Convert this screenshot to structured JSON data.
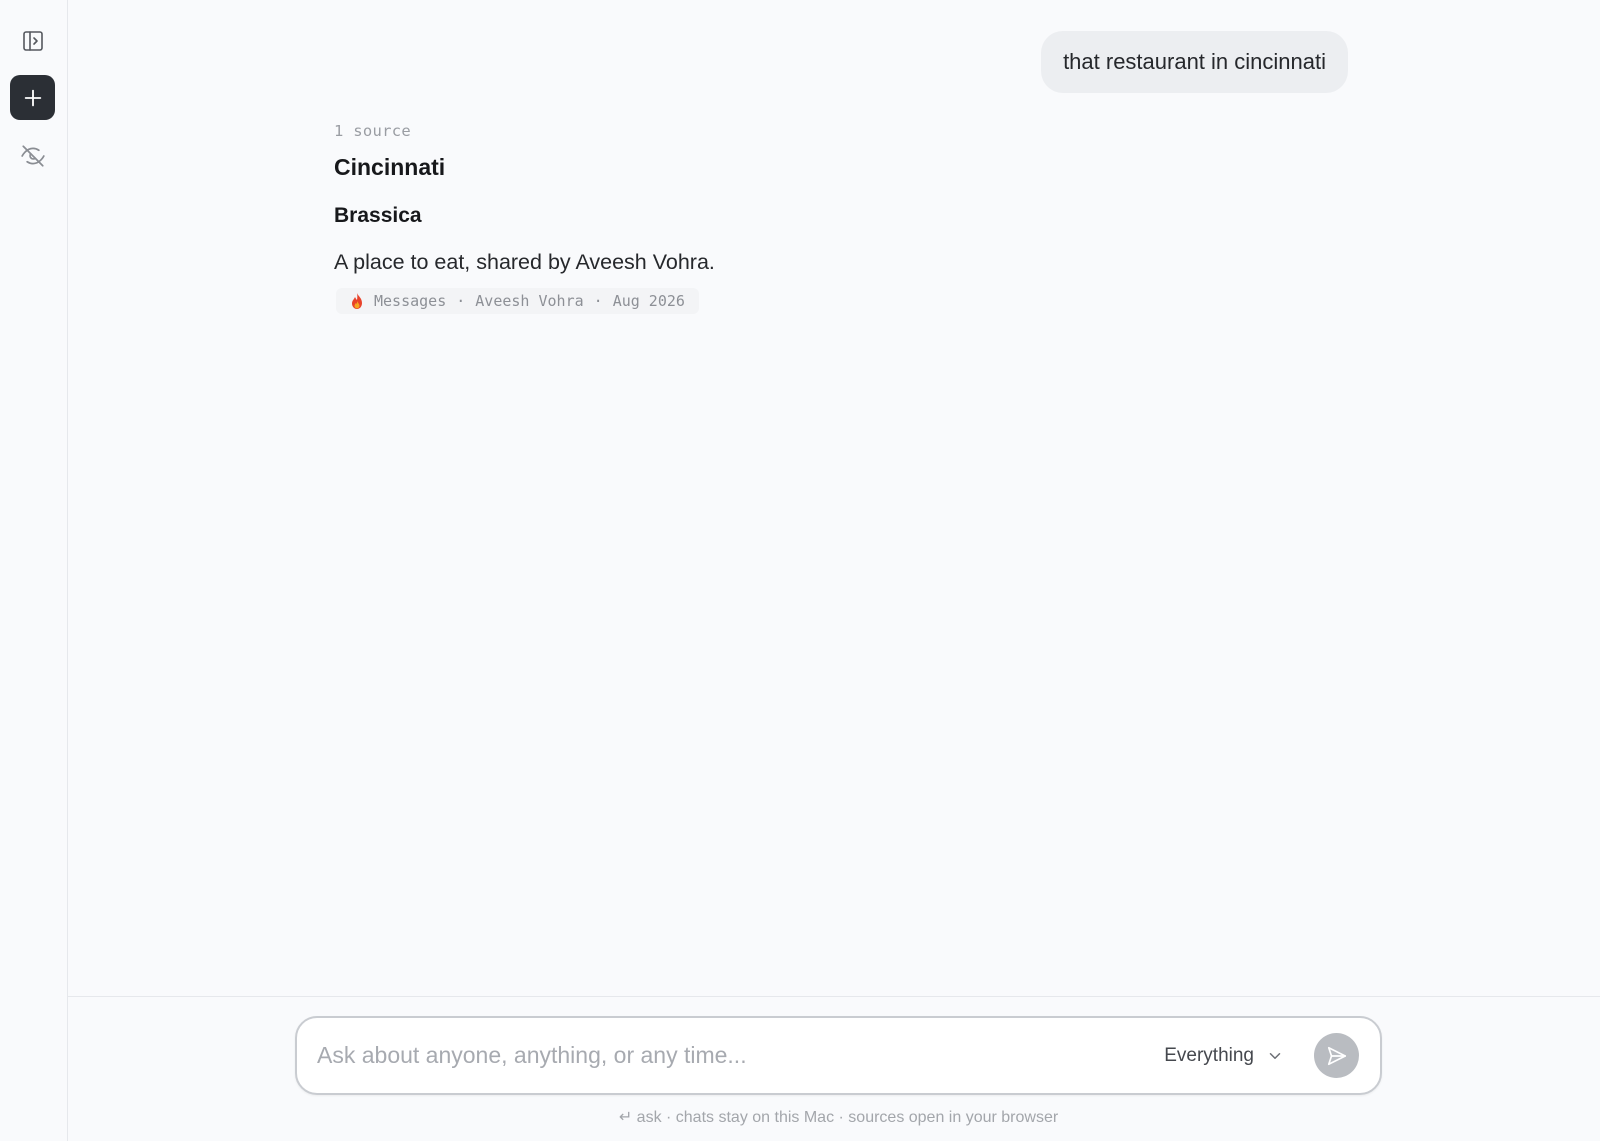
{
  "sidebar": {
    "toggle_icon": "sidebar-toggle-icon",
    "new_chat_icon": "plus-icon",
    "private_icon": "eye-slash-icon"
  },
  "conversation": {
    "user_message": "that restaurant in cincinnati",
    "answer": {
      "source_count": "1 source",
      "heading": "Cincinnati",
      "subheading": "Brassica",
      "description": "A place to eat, shared by Aveesh Vohra.",
      "source": {
        "icon": "messages-flame-icon",
        "app": "Messages",
        "separator": "·",
        "person": "Aveesh Vohra",
        "date": "Aug 2026"
      }
    }
  },
  "composer": {
    "placeholder": "Ask about anyone, anything, or any time...",
    "value": "",
    "scope": "Everything",
    "send_icon": "send-icon"
  },
  "footer": {
    "hint": "↵ ask · chats stay on this Mac · sources open in your browser"
  },
  "colors": {
    "background": "#f9fafc",
    "new_button": "#2b2f35",
    "bubble": "#eceef1",
    "send_button": "#b9bcc1"
  }
}
